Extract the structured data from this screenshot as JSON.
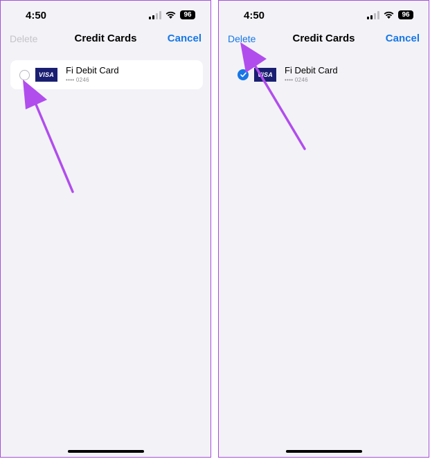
{
  "colors": {
    "accent": "#1677e6",
    "arrow": "#b14ded",
    "frame": "#a64fd8"
  },
  "screens": [
    {
      "status": {
        "time": "4:50",
        "battery": "96"
      },
      "nav": {
        "delete_label": "Delete",
        "title": "Credit Cards",
        "cancel_label": "Cancel"
      },
      "card": {
        "brand": "VISA",
        "name": "Fi Debit Card",
        "number": "•••• 0246",
        "selected": false
      }
    },
    {
      "status": {
        "time": "4:50",
        "battery": "96"
      },
      "nav": {
        "delete_label": "Delete",
        "title": "Credit Cards",
        "cancel_label": "Cancel"
      },
      "card": {
        "brand": "VISA",
        "name": "Fi Debit Card",
        "number": "•••• 0246",
        "selected": true
      }
    }
  ]
}
